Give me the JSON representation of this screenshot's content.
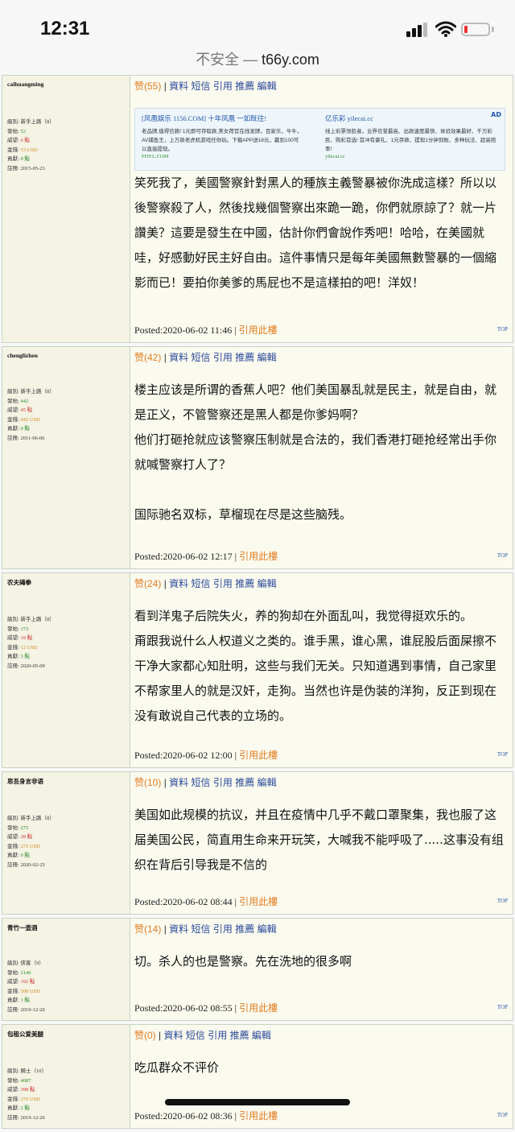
{
  "status": {
    "time": "12:31"
  },
  "browser": {
    "insecure_label": "不安全",
    "dash": " — ",
    "domain": "t66y.com"
  },
  "labels": {
    "level": "級別:",
    "posts": "發帖:",
    "prestige": "威望:",
    "money": "金錢:",
    "contrib": "貢獻:",
    "reg": "註冊:",
    "like": "赞",
    "sep": " | ",
    "data": "資料",
    "sms": "短信",
    "quote": "引用",
    "recommend": "推薦",
    "edit": "編輯",
    "posted": "Posted:",
    "quote_floor": "引用此樓",
    "top": "TOP"
  },
  "ad": {
    "tag": "AD",
    "left": {
      "title": "[凤凰娱乐 1156.COM] 十年凤凰 一如既往!",
      "desc": "老品牌,值得信赖! 1元即可存取款,美女荷官在线发牌，百家乐，牛牛，AV捕鱼王，上万款老虎机游戏任你玩。下载APP送18元，赢到100可以直接提现。",
      "url": "FHYL.COM"
    },
    "right": {
      "title": "亿乐彩 yilecai.cc",
      "desc": "线上彩票领航者，业界信誉最高、出款速度最快、体验效果最好、千万彩民、购彩首选! 首冲有豪礼、1元存款、提现1分钟到账、多种玩法、超高赔率!",
      "url": "yilecai.cc"
    }
  },
  "posts": [
    {
      "username": "caihuangming",
      "level": "新手上路（8）",
      "posts": "53",
      "prestige": "6 點",
      "money": "53 USD",
      "contrib": "0 點",
      "reg": "2015-05-23",
      "likes": "(55)",
      "body": [
        "笑死我了，美國警察針對黑人的種族主義警暴被你洗成這樣？所以以後警察殺了人，然後找幾個警察出來跪一跪，你們就原諒了？就一片讚美？這要是發生在中國，估計你們會說作秀吧！哈哈，在美國就哇，好感動好民主好自由。這件事情只是每年美國無數警暴的一個縮影而已！要拍你美爹的馬屁也不是這樣拍的吧！洋奴！"
      ],
      "posted": "2020-06-02 11:46"
    },
    {
      "username": "chenglizhen",
      "level": "新手上路（8）",
      "posts": "442",
      "prestige": "45 點",
      "money": "442 USD",
      "contrib": "0 點",
      "reg": "2011-06-06",
      "likes": "(42)",
      "body": [
        "楼主应该是所谓的香蕉人吧？他们美国暴乱就是民主，就是自由，就是正义，不管警察还是黑人都是你爹妈啊？",
        "他们打砸抢就应该警察压制就是合法的，我们香港打砸抢经常出手你就喊警察打人了？",
        "",
        "国际驰名双标，草榴现在尽是这些脑残。"
      ],
      "posted": "2020-06-02 12:17"
    },
    {
      "username": "农夫碡拳",
      "level": "新手上路（8）",
      "posts": "173",
      "prestige": "19 點",
      "money": "12 USD",
      "contrib": "3 點",
      "reg": "2020-05-09",
      "likes": "(24)",
      "body": [
        "看到洋鬼子后院失火，养的狗却在外面乱叫，我觉得挺欢乐的。",
        "甭跟我说什么人权道义之类的。谁手黑，谁心黑，谁屁股后面屎擦不干净大家都心知肚明，这些与我们无关。只知道遇到事情，自己家里不帮家里人的就是汉奸，走狗。当然也许是伪装的洋狗，反正到现在没有敢说自己代表的立场的。"
      ],
      "posted": "2020-06-02 12:00"
    },
    {
      "username": "思吾身言非语",
      "level": "新手上路（8）",
      "posts": "275",
      "prestige": "28 點",
      "money": "275 USD",
      "contrib": "0 點",
      "reg": "2020-02-25",
      "likes": "(10)",
      "body": [
        "美国如此规模的抗议，并且在疫情中几乎不戴口罩聚集，我也服了这届美国公民，简直用生命来开玩笑，大喊我不能呼吸了.....这事没有组织在背后引导我是不信的"
      ],
      "posted": "2020-06-02 08:44"
    },
    {
      "username": "青竹一壶酒",
      "level": "俠客（9）",
      "posts": "2146",
      "prestige": "192 點",
      "money": "508 USD",
      "contrib": "1 點",
      "reg": "2019-12-20",
      "likes": "(14)",
      "body": [
        "切。杀人的也是警察。先在洗地的很多啊"
      ],
      "posted": "2020-06-02 08:55"
    },
    {
      "username": "包租公爱美腿",
      "level": "騎士（10）",
      "posts": "4087",
      "prestige": "398 點",
      "money": "270 USD",
      "contrib": "2 點",
      "reg": "2019-12-26",
      "likes": "(0)",
      "body": [
        "吃瓜群众不评价"
      ],
      "posted": "2020-06-02 08:36"
    }
  ]
}
